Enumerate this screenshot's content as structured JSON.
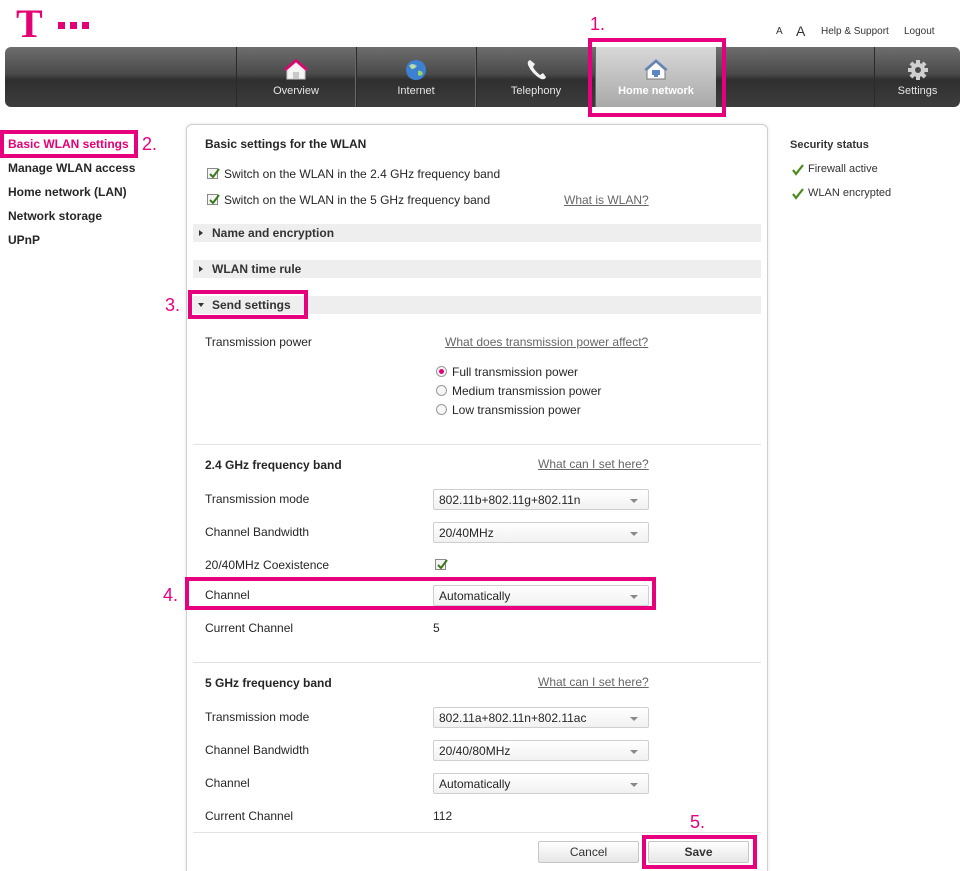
{
  "brand": {
    "logo_letter": "T",
    "color": "#e20074"
  },
  "header": {
    "font_small": "A",
    "font_large": "A",
    "help_support": "Help & Support",
    "logout": "Logout"
  },
  "nav": {
    "items": [
      {
        "label": "Overview",
        "icon": "home-icon"
      },
      {
        "label": "Internet",
        "icon": "globe-icon"
      },
      {
        "label": "Telephony",
        "icon": "phone-icon"
      },
      {
        "label": "Home network",
        "icon": "home-network-icon",
        "active": true
      },
      {
        "label": "Settings",
        "icon": "gear-icon"
      }
    ]
  },
  "annotations": {
    "n1": "1.",
    "n2": "2.",
    "n3": "3.",
    "n4": "4.",
    "n5": "5.",
    "color": "#e6007e"
  },
  "sidebar": {
    "items": [
      {
        "label": "Basic WLAN settings",
        "active": true
      },
      {
        "label": "Manage WLAN access"
      },
      {
        "label": "Home network (LAN)"
      },
      {
        "label": "Network storage"
      },
      {
        "label": "UPnP"
      }
    ]
  },
  "main": {
    "title": "Basic settings for the WLAN",
    "wlan24": {
      "label": "Switch on the WLAN in the 2.4 GHz frequency band",
      "checked": true
    },
    "wlan5": {
      "label": "Switch on the WLAN in the 5 GHz frequency band",
      "checked": true
    },
    "what_is_wlan": "What is WLAN?",
    "sections": {
      "name_enc": "Name and encryption",
      "time_rule": "WLAN time rule",
      "send": "Send settings"
    },
    "transmission_power": {
      "label": "Transmission power",
      "help": "What does transmission power affect?",
      "options": [
        "Full transmission power",
        "Medium transmission power",
        "Low transmission power"
      ],
      "selected": "Full transmission power"
    },
    "band24": {
      "title": "2.4 GHz frequency band",
      "help": "What can I set here?",
      "mode_label": "Transmission mode",
      "mode_value": "802.11b+802.11g+802.11n",
      "bw_label": "Channel Bandwidth",
      "bw_value": "20/40MHz",
      "coex_label": "20/40MHz Coexistence",
      "coex_checked": true,
      "channel_label": "Channel",
      "channel_value": "Automatically",
      "current_label": "Current Channel",
      "current_value": "5"
    },
    "band5": {
      "title": "5 GHz frequency band",
      "help": "What can I set here?",
      "mode_label": "Transmission mode",
      "mode_value": "802.11a+802.11n+802.11ac",
      "bw_label": "Channel Bandwidth",
      "bw_value": "20/40/80MHz",
      "channel_label": "Channel",
      "channel_value": "Automatically",
      "current_label": "Current Channel",
      "current_value": "112"
    },
    "cancel": "Cancel",
    "save": "Save"
  },
  "security": {
    "title": "Security status",
    "items": [
      "Firewall active",
      "WLAN encrypted"
    ]
  }
}
